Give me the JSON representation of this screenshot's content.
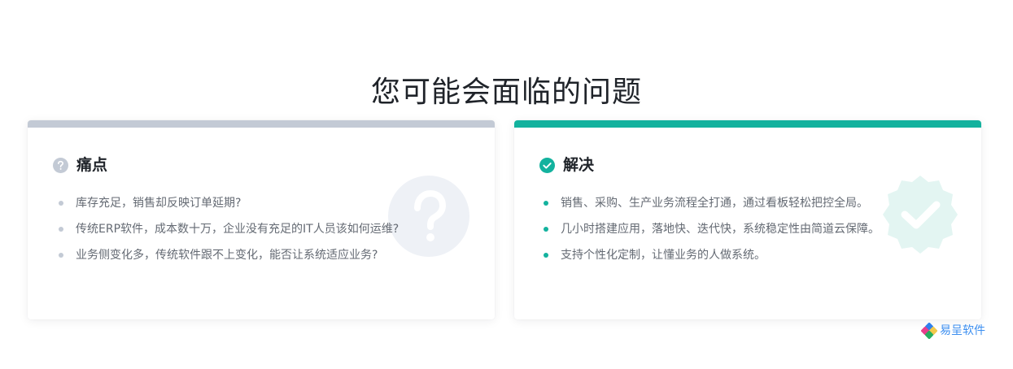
{
  "section": {
    "title": "您可能会面临的问题"
  },
  "pain_card": {
    "heading": "痛点",
    "icon": "question-circle-icon",
    "accent_color": "#c3cad5",
    "items": [
      "库存充足，销售却反映订单延期?",
      "传统ERP软件，成本数十万，企业没有充足的IT人员该如何运维?",
      "业务侧变化多，传统软件跟不上变化，能否让系统适应业务?"
    ]
  },
  "solve_card": {
    "heading": "解决",
    "icon": "check-circle-icon",
    "accent_color": "#13b29e",
    "items": [
      "销售、采购、生产业务流程全打通，通过看板轻松把控全局。",
      "几小时搭建应用，落地快、迭代快，系统稳定性由简道云保障。",
      "支持个性化定制，让懂业务的人做系统。"
    ]
  },
  "watermark": {
    "text": "易呈软件",
    "icon": "brand-logo-icon"
  }
}
